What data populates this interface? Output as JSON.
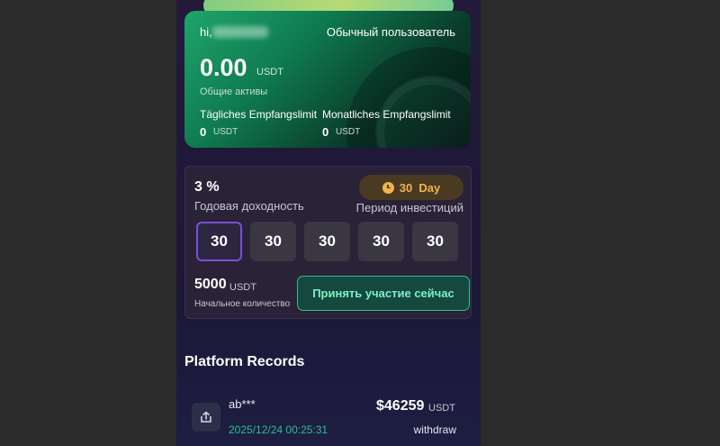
{
  "asset_card": {
    "greeting": "hi,",
    "user_type": "Обычный пользователь",
    "balance": "0.00",
    "balance_unit": "USDT",
    "assets_label": "Общие активы",
    "daily_limit_label": "Tägliches Empfangslimit",
    "monthly_limit_label": "Monatliches Empfangslimit",
    "daily_limit_value": "0",
    "monthly_limit_value": "0",
    "limit_unit": "USDT"
  },
  "invest": {
    "rate": "3 %",
    "rate_label": "Годовая доходность",
    "period_badge": "30  Day",
    "period_label": "Период инвестиций",
    "day_options": [
      "30",
      "30",
      "30",
      "30",
      "30"
    ],
    "selected_index": 0,
    "amount": "5000",
    "amount_unit": "USDT",
    "amount_label": "Начальное количество",
    "join_button": "Принять участие сейчас"
  },
  "records": {
    "title": "Platform Records",
    "items": [
      {
        "user": "ab***",
        "time": "2025/12/24 00:25:31",
        "amount": "$46259",
        "unit": "USDT",
        "type": "withdraw"
      }
    ]
  },
  "colors": {
    "accent_green": "#2fbf8c",
    "accent_purple": "#7b4fd6",
    "badge_orange": "#f1b54a"
  }
}
